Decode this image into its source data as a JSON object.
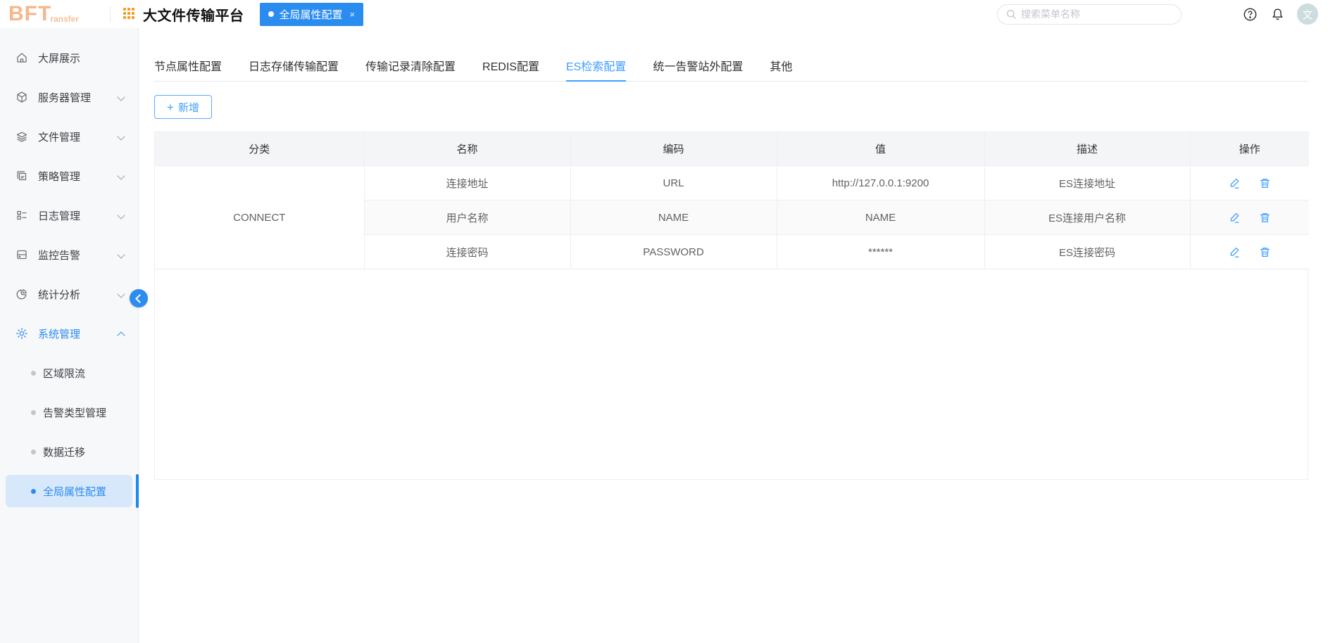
{
  "header": {
    "logo_text": "BFT",
    "logo_sub": "ransfer",
    "app_title": "大文件传输平台",
    "chip_label": "全局属性配置",
    "chip_close": "×",
    "search_placeholder": "搜索菜单名称",
    "avatar_text": "文"
  },
  "sidebar": {
    "items": [
      {
        "label": "大屏展示",
        "icon": "home-icon",
        "expandable": false,
        "active": false
      },
      {
        "label": "服务器管理",
        "icon": "server-icon",
        "expandable": true,
        "active": false
      },
      {
        "label": "文件管理",
        "icon": "files-icon",
        "expandable": true,
        "active": false
      },
      {
        "label": "策略管理",
        "icon": "strategy-icon",
        "expandable": true,
        "active": false
      },
      {
        "label": "日志管理",
        "icon": "log-icon",
        "expandable": true,
        "active": false
      },
      {
        "label": "监控告警",
        "icon": "monitor-icon",
        "expandable": true,
        "active": false
      },
      {
        "label": "统计分析",
        "icon": "stats-icon",
        "expandable": true,
        "active": false
      },
      {
        "label": "系统管理",
        "icon": "gear-icon",
        "expandable": true,
        "expanded": true,
        "active": true
      }
    ],
    "subitems": [
      {
        "label": "区域限流",
        "selected": false
      },
      {
        "label": "告警类型管理",
        "selected": false
      },
      {
        "label": "数据迁移",
        "selected": false
      },
      {
        "label": "全局属性配置",
        "selected": true
      }
    ]
  },
  "tabs": {
    "items": [
      "节点属性配置",
      "日志存储传输配置",
      "传输记录清除配置",
      "REDIS配置",
      "ES检索配置",
      "统一告警站外配置",
      "其他"
    ],
    "active": "ES检索配置"
  },
  "toolbar": {
    "add_label": "新增",
    "add_plus": "+"
  },
  "table": {
    "columns": [
      "分类",
      "名称",
      "编码",
      "值",
      "描述",
      "操作"
    ],
    "category": "CONNECT",
    "rows": [
      {
        "name": "连接地址",
        "code": "URL",
        "value": "http://127.0.0.1:9200",
        "desc": "ES连接地址"
      },
      {
        "name": "用户名称",
        "code": "NAME",
        "value": "NAME",
        "desc": "ES连接用户名称"
      },
      {
        "name": "连接密码",
        "code": "PASSWORD",
        "value": "******",
        "desc": "ES连接密码"
      }
    ]
  },
  "colors": {
    "chip_blue": "#2b8cf0",
    "link_blue": "#409eff",
    "logo_orange": "#f5b78c",
    "grid_orange": "#f59a23",
    "sidebar_bg": "#f7f8fa",
    "selected_bg": "#d8e8fb",
    "table_header_bg": "#f4f5f7",
    "stripe_bg": "#fafafa",
    "border": "#ebeef5",
    "avatar_bg": "#ccdcdf"
  }
}
